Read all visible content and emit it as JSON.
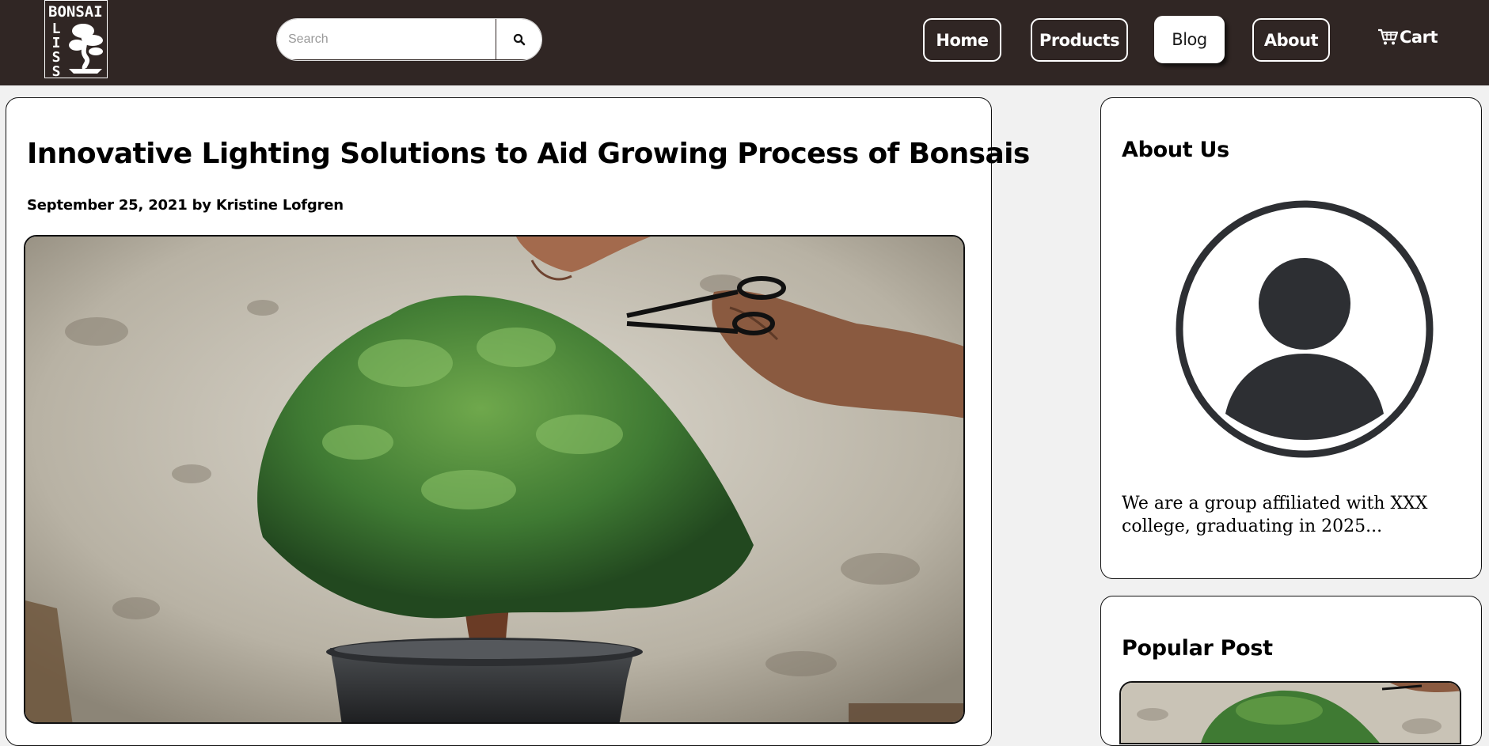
{
  "header": {
    "logo": {
      "word": "BONSAI",
      "side": [
        "L",
        "I",
        "S",
        "S"
      ],
      "icon": "bonsai-tree-icon"
    },
    "search": {
      "placeholder": "Search",
      "value": "",
      "icon": "search-icon"
    },
    "nav": [
      {
        "label": "Home",
        "active": false
      },
      {
        "label": "Products",
        "active": false
      },
      {
        "label": "Blog",
        "active": true
      },
      {
        "label": "About",
        "active": false
      }
    ],
    "cart": {
      "label": "Cart",
      "icon": "shopping-cart-icon"
    }
  },
  "post": {
    "title": "Innovative Lighting Solutions to Aid Growing Process of Bonsais",
    "meta": "September 25, 2021 by Kristine Lofgren",
    "image": "bonsai-pruning-photo"
  },
  "sidebar": {
    "about": {
      "heading": "About Us",
      "avatar_icon": "user-avatar-icon",
      "text": "We are a group affiliated with XXX college, graduating in 2025..."
    },
    "popular": {
      "heading": "Popular Post",
      "image": "bonsai-pruning-thumbnail"
    }
  },
  "colors": {
    "header_bg": "#302624",
    "page_bg": "#f1f1f1",
    "card_bg": "#ffffff",
    "avatar": "#2d2f33"
  }
}
